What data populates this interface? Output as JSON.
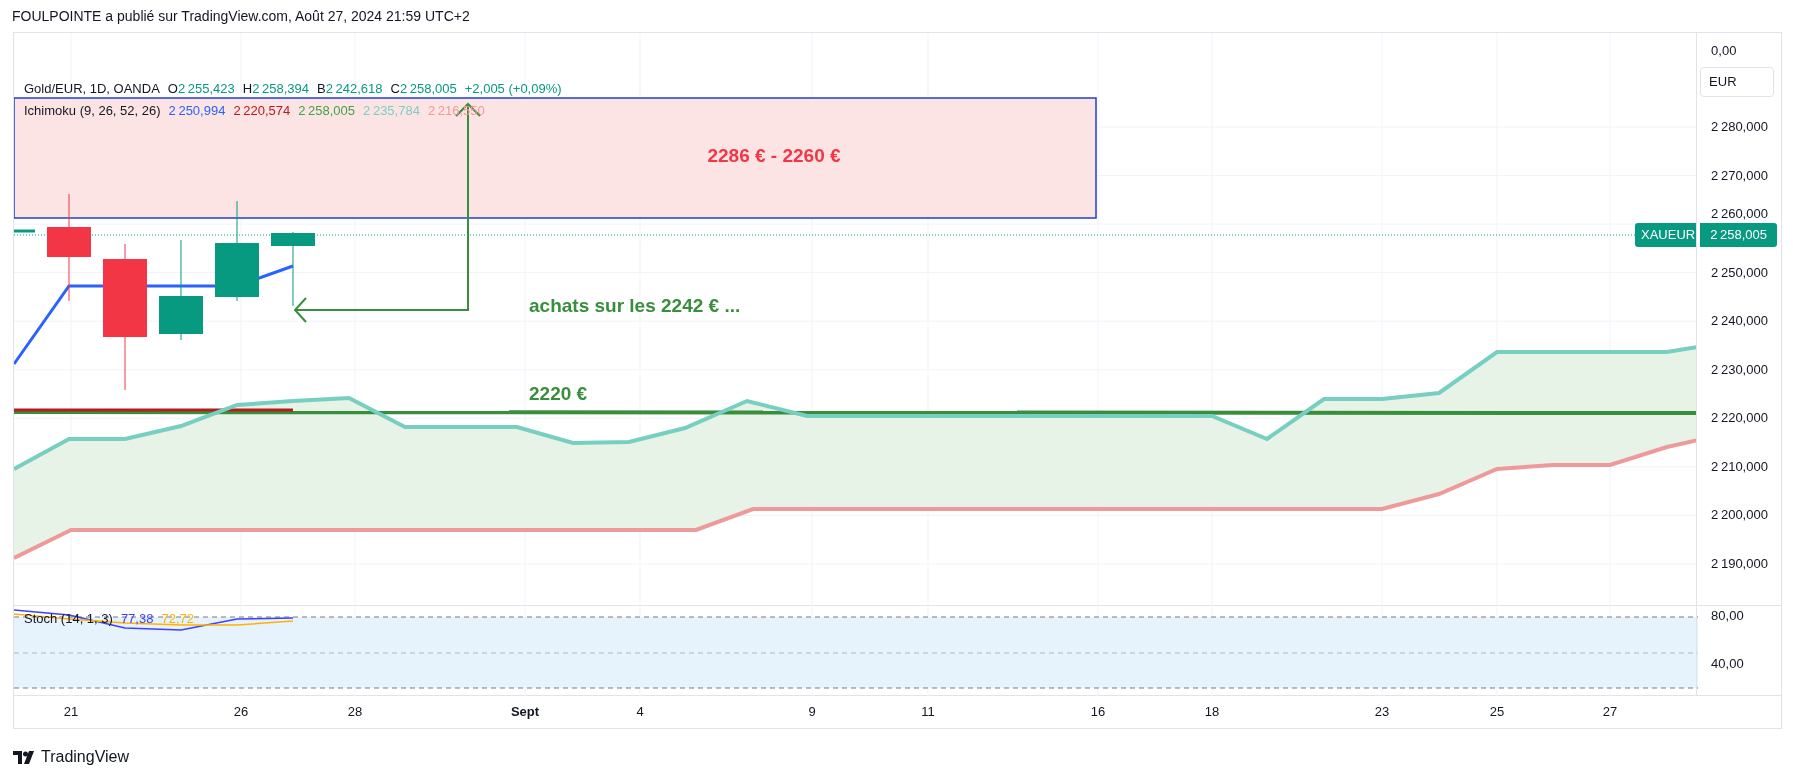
{
  "header": {
    "text": "FOULPOINTE a publié sur TradingView.com, Août 27, 2024 21:59 UTC+2"
  },
  "legend": {
    "symbol": "Gold/EUR, 1D, OANDA",
    "ohlc": [
      {
        "label": "O",
        "value": "2 255,423"
      },
      {
        "label": "H",
        "value": "2 258,394"
      },
      {
        "label": "B",
        "value": "2 242,618"
      },
      {
        "label": "C",
        "value": "2 258,005"
      }
    ],
    "change": "+2,005 (+0,09%)"
  },
  "indicator": {
    "name": "Ichimoku (9, 26, 52, 26)",
    "values": [
      {
        "text": "2 250,994",
        "color": "#2962ff"
      },
      {
        "text": "2 220,574",
        "color": "#b71c1c"
      },
      {
        "text": "2 258,005",
        "color": "#43a047"
      },
      {
        "text": "2 235,784",
        "color": "#80cbc4"
      },
      {
        "text": "2 216,550",
        "color": "#ef9a9a"
      }
    ]
  },
  "annotations": [
    {
      "kind": "zone",
      "text": "2286 € - 2260 €",
      "color": "#f23645"
    },
    {
      "kind": "note",
      "text": "achats sur les 2242 € ...",
      "color": "#388e3c"
    },
    {
      "kind": "note",
      "text": "2220 €",
      "color": "#388e3c"
    }
  ],
  "price_axis": {
    "top_label": "0,00",
    "currency": "EUR",
    "ticks": [
      "2 280,000",
      "2 270,000",
      "2 260,000",
      "2 250,000",
      "2 240,000",
      "2 230,000",
      "2 220,000",
      "2 210,000",
      "2 200,000",
      "2 190,000"
    ],
    "last_price": {
      "symbol": "XAUEUR",
      "value": "2 258,005"
    }
  },
  "stoch": {
    "name": "Stoch (14, 1, 3)",
    "values": [
      {
        "text": "77,38",
        "color": "#3f3fff"
      },
      {
        "text": "72,72",
        "color": "#ffb300"
      }
    ],
    "ticks": [
      "80,00",
      "40,00"
    ]
  },
  "time_axis": [
    {
      "label": "21",
      "bold": false
    },
    {
      "label": "26",
      "bold": false
    },
    {
      "label": "28",
      "bold": false
    },
    {
      "label": "Sept",
      "bold": true
    },
    {
      "label": "4",
      "bold": false
    },
    {
      "label": "9",
      "bold": false
    },
    {
      "label": "11",
      "bold": false
    },
    {
      "label": "16",
      "bold": false
    },
    {
      "label": "18",
      "bold": false
    },
    {
      "label": "23",
      "bold": false
    },
    {
      "label": "25",
      "bold": false
    },
    {
      "label": "27",
      "bold": false
    }
  ],
  "footer": {
    "brand": "TradingView"
  }
}
